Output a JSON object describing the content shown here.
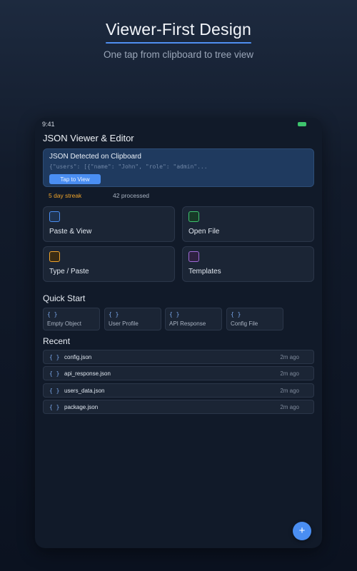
{
  "hero": {
    "title": "Viewer-First Design",
    "subtitle": "One tap from clipboard to tree view"
  },
  "status_bar": {
    "time": "9:41"
  },
  "app": {
    "title": "JSON Viewer & Editor"
  },
  "clipboard_banner": {
    "title": "JSON Detected on Clipboard",
    "preview": "{\"users\": [{\"name\": \"John\", \"role\": \"admin\"...",
    "button_label": "Tap to View"
  },
  "stats": {
    "streak": "5 day streak",
    "processed": "42 processed"
  },
  "actions": [
    {
      "label": "Paste & View",
      "icon": "paste-icon",
      "color": "#4a8ef2"
    },
    {
      "label": "Open File",
      "icon": "file-icon",
      "color": "#3ec46d"
    },
    {
      "label": "Type / Paste",
      "icon": "edit-icon",
      "color": "#f0a42a"
    },
    {
      "label": "Templates",
      "icon": "template-icon",
      "color": "#a06ad8"
    }
  ],
  "quick_start": {
    "title": "Quick Start",
    "items": [
      {
        "icon": "{ }",
        "label": "Empty Object"
      },
      {
        "icon": "{ }",
        "label": "User Profile"
      },
      {
        "icon": "{ }",
        "label": "API Response"
      },
      {
        "icon": "{ }",
        "label": "Config File"
      }
    ]
  },
  "recent": {
    "title": "Recent",
    "items": [
      {
        "icon": "{ }",
        "name": "config.json",
        "time": "2m ago"
      },
      {
        "icon": "{ }",
        "name": "api_response.json",
        "time": "2m ago"
      },
      {
        "icon": "{ }",
        "name": "users_data.json",
        "time": "2m ago"
      },
      {
        "icon": "{ }",
        "name": "package.json",
        "time": "2m ago"
      }
    ]
  },
  "fab": {
    "label": "+"
  }
}
